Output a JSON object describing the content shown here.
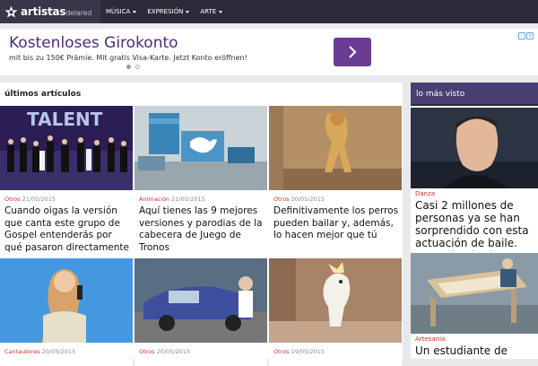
{
  "header": {
    "logo_main": "artistas",
    "logo_sub": "delared",
    "nav": [
      "MÚSICA",
      "EXPRESIÓN",
      "ARTE"
    ]
  },
  "ad": {
    "title": "Kostenloses Girokonto",
    "subtitle": "mit bis zu 150€ Prämie. Mit gratis Visa-Karte. Jetzt Konto eröffnen!",
    "arrow_icon": "chevron-right-icon",
    "badge": "i x"
  },
  "main": {
    "section_title": "últimos artículos",
    "articles": [
      {
        "category": "Otros",
        "date": "21/05/2015",
        "title": "Cuando oigas la versión que canta este grupo de Gospel entenderás por qué pasaron directamente a semifinales"
      },
      {
        "category": "Animación",
        "date": "21/05/2015",
        "title": "Aquí tienes las 9 mejores versiones y parodias de la cabecera de Juego de Tronos"
      },
      {
        "category": "Otros",
        "date": "20/05/2015",
        "title": "Definitivamente los perros pueden bailar y, además, lo hacen mejor que tú"
      },
      {
        "category": "Cantautores",
        "date": "20/05/2015",
        "title": ""
      },
      {
        "category": "Otros",
        "date": "20/05/2015",
        "title": ""
      },
      {
        "category": "Otros",
        "date": "19/05/2015",
        "title": ""
      }
    ]
  },
  "sidebar": {
    "title": "lo más visto",
    "items": [
      {
        "category": "Danza",
        "title": "Casi 2 millones de personas ya se han sorprendido con esta actuación de baile. ¡No te la pierdas!"
      },
      {
        "category": "Artesanía",
        "title": "Un estudiante de"
      }
    ]
  }
}
